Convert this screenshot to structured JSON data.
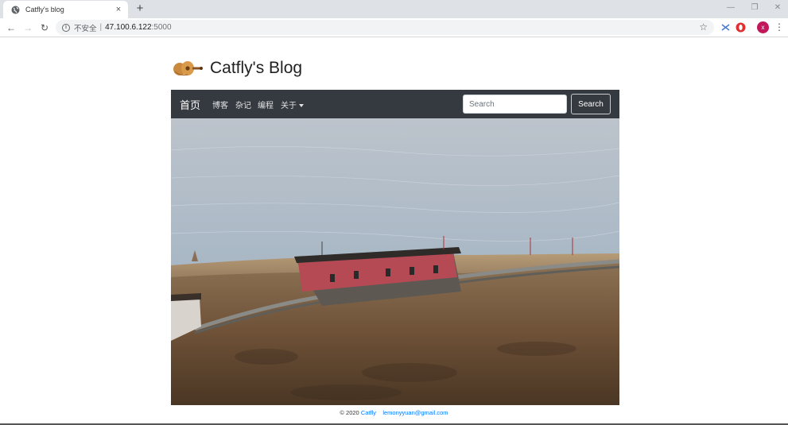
{
  "browser": {
    "tab_title": "Catfly's blog",
    "tab_close": "×",
    "new_tab": "+",
    "security_label": "不安全",
    "url_host": "47.100.6.122",
    "url_port": ":5000",
    "avatar_letter": "x"
  },
  "site": {
    "title": "Catfly's Blog",
    "nav": {
      "home": "首页",
      "links": [
        "博客",
        "杂记",
        "编程",
        "关于"
      ]
    },
    "search": {
      "placeholder": "Search",
      "button": "Search"
    },
    "footer": {
      "copyright": "© 2020",
      "author": "Catfly",
      "email": "lemonyyuan@gmail.com"
    }
  },
  "colors": {
    "navbar_bg": "#343a40",
    "link_blue": "#007bff",
    "avatar_bg": "#c2185b"
  }
}
